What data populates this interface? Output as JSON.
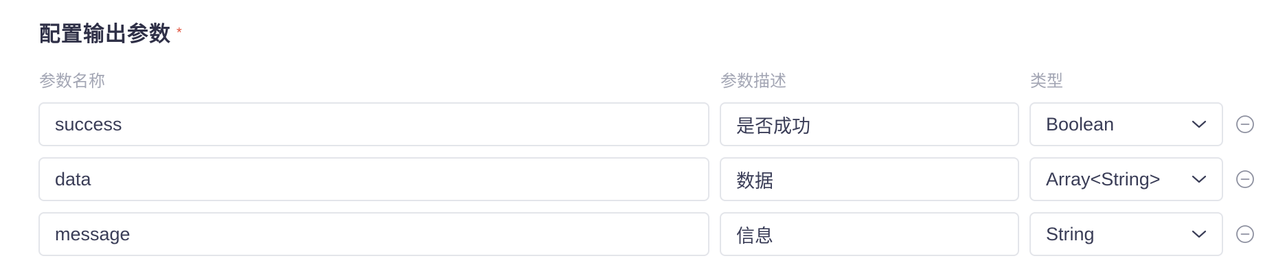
{
  "section": {
    "title": "配置输出参数",
    "required_mark": "*"
  },
  "columns": {
    "name": "参数名称",
    "description": "参数描述",
    "type": "类型"
  },
  "params": [
    {
      "name": "success",
      "description": "是否成功",
      "type": "Boolean"
    },
    {
      "name": "data",
      "description": "数据",
      "type": "Array<String>"
    },
    {
      "name": "message",
      "description": "信息",
      "type": "String"
    }
  ],
  "icons": {
    "type_select": "chevron-down-icon",
    "remove": "minus-circle-icon"
  },
  "colors": {
    "required": "#e0553f",
    "border": "#e3e5ea",
    "label": "#a3a6b4",
    "text": "#3a3d57"
  }
}
